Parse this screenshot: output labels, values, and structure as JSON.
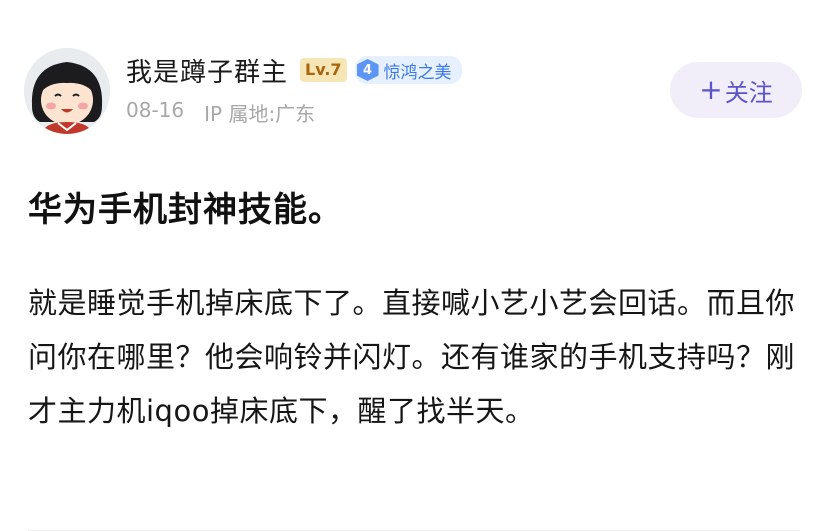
{
  "author": {
    "username": "我是蹲子群主",
    "level": "Lv.7",
    "title_badge_number": "4",
    "title_badge_text": "惊鸿之美",
    "date": "08-16",
    "ip_location": "IP 属地:广东"
  },
  "follow_button": {
    "plus": "+",
    "label": "关注"
  },
  "post": {
    "title": "华为手机封神技能。",
    "body": "就是睡觉手机掉床底下了。直接喊小艺小艺会回话。而且你问你在哪里？他会响铃并闪灯。还有谁家的手机支持吗？刚才主力机iqoo掉床底下，醒了找半天。"
  },
  "colors": {
    "accent": "#5b53c9",
    "follow_bg": "#f1eef9",
    "level_bg": "#f7e6b5",
    "level_text": "#a8640f",
    "badge_blue": "#3a78e8",
    "meta_gray": "#a7a7a7"
  },
  "icons": {
    "avatar": "cartoon-girl-avatar",
    "title_badge": "hexagon-rank-icon"
  }
}
